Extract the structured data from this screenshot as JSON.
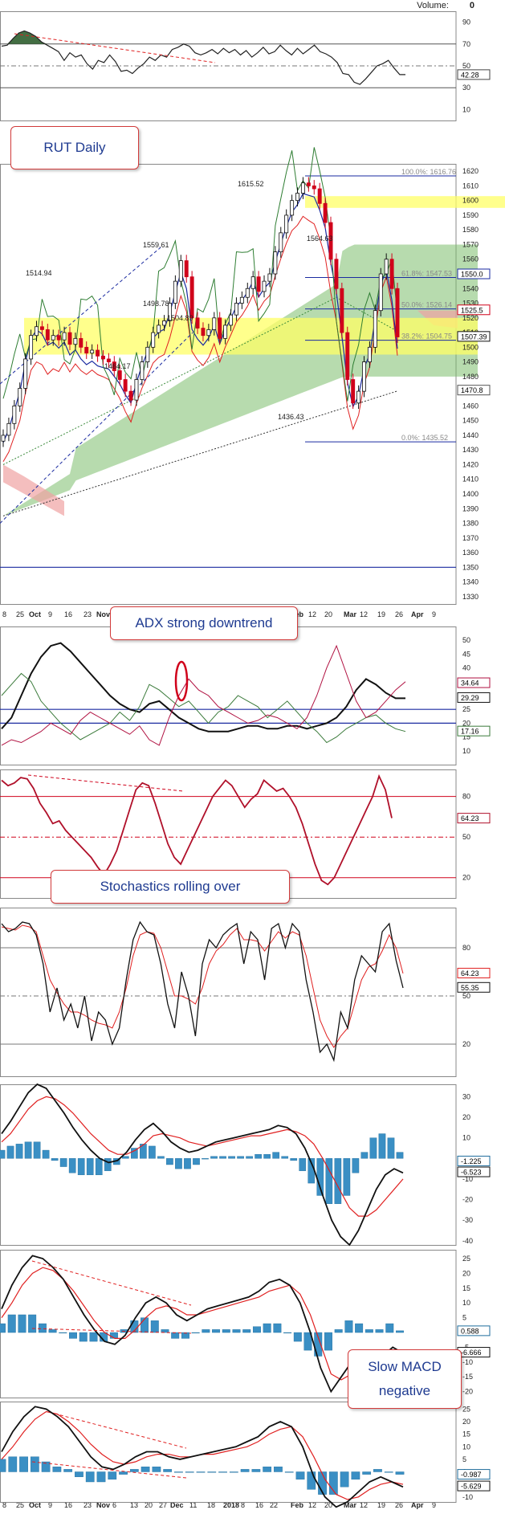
{
  "volume": {
    "label": "Volume:",
    "value": "0"
  },
  "callouts": {
    "rut": "RUT Daily",
    "adx": "ADX strong downtrend",
    "stoch": "Stochastics rolling over",
    "slow_macd": "Slow MACD negative"
  },
  "x_axis": {
    "labels": [
      "8",
      "25",
      "Oct",
      "9",
      "16",
      "23",
      "Nov",
      "6",
      "13",
      "20",
      "27",
      "Dec",
      "11",
      "18",
      "2018",
      "8",
      "16",
      "22",
      "Feb",
      "12",
      "20",
      "Mar",
      "12",
      "19",
      "26",
      "Apr",
      "9"
    ],
    "bold": [
      "Oct",
      "Nov",
      "Dec",
      "2018",
      "Feb",
      "Mar",
      "Apr"
    ],
    "num_days": 140
  },
  "colors": {
    "price_up": "#111111",
    "price_down": "#d0021b",
    "red_line": "#e02020",
    "blue_line": "#1a2aa0",
    "green_line": "#2e7d32",
    "cloud_green": "#7cbd6b",
    "cloud_red": "#f0a3a3",
    "highlight": "#ffff66",
    "macd_hist": "#3a8fc4",
    "rsi_fill": "#2f5e2f"
  },
  "chart_data": [
    {
      "type": "line",
      "panel": "RSI",
      "y_ticks": [
        "90",
        "70",
        "50",
        "30",
        "10"
      ],
      "last_label": "42.28",
      "levels": [
        70,
        50,
        30
      ],
      "series": [
        {
          "values": [
            68,
            69,
            75,
            80,
            82,
            80,
            77,
            72,
            69,
            66,
            63,
            55,
            62,
            58,
            60,
            52,
            47,
            55,
            53,
            60,
            54,
            45,
            46,
            43,
            48,
            52,
            58,
            55,
            60,
            58,
            65,
            67,
            70,
            68,
            62,
            60,
            62,
            65,
            61,
            66,
            62,
            65,
            60,
            64,
            58,
            62,
            67,
            61,
            63,
            69,
            64,
            60,
            66,
            61,
            65,
            69,
            63,
            61,
            58,
            53,
            43,
            42,
            35,
            33,
            38,
            44,
            50,
            52,
            55,
            48,
            42,
            42
          ]
        }
      ]
    },
    {
      "type": "candlestick",
      "panel": "price",
      "title": "RUT Daily",
      "y_ticks": [
        "1620",
        "1610",
        "1600",
        "1590",
        "1580",
        "1570",
        "1560",
        "1550",
        "1540",
        "1530",
        "1520",
        "1510",
        "1500",
        "1490",
        "1480",
        "1470",
        "1460",
        "1450",
        "1440",
        "1430",
        "1420",
        "1410",
        "1400",
        "1390",
        "1380",
        "1370",
        "1360",
        "1350",
        "1340",
        "1330"
      ],
      "ylim": [
        1325,
        1625
      ],
      "annotations": [
        "1615.52",
        "1559.61",
        "1514.94",
        "1498.78",
        "1504.89",
        "1464.17",
        "1564.63",
        "1436.43"
      ],
      "fib_levels": [
        {
          "label": "100.0%: 1616.76",
          "value": 1616.76
        },
        {
          "label": "61.8%: 1547.53",
          "value": 1547.53
        },
        {
          "label": "50.0%: 1526.14",
          "value": 1526.14
        },
        {
          "label": "38.2%: 1504.75",
          "value": 1504.75
        },
        {
          "label": "0.0%: 1435.52",
          "value": 1435.52
        }
      ],
      "last_labels": [
        "1550.0",
        "1525.5",
        "1507.39",
        "1470.8"
      ],
      "highlight_zones": [
        [
          1495,
          1520
        ],
        [
          1595,
          1603
        ]
      ],
      "closes": [
        1440,
        1448,
        1460,
        1472,
        1492,
        1508,
        1514,
        1512,
        1505,
        1508,
        1505,
        1510,
        1502,
        1506,
        1500,
        1496,
        1498,
        1494,
        1492,
        1490,
        1484,
        1478,
        1470,
        1464,
        1478,
        1490,
        1500,
        1510,
        1515,
        1518,
        1530,
        1545,
        1559,
        1548,
        1520,
        1513,
        1508,
        1512,
        1520,
        1506,
        1515,
        1522,
        1530,
        1534,
        1540,
        1548,
        1538,
        1545,
        1550,
        1565,
        1578,
        1590,
        1600,
        1605,
        1612,
        1610,
        1608,
        1598,
        1585,
        1560,
        1540,
        1510,
        1478,
        1462,
        1470,
        1490,
        1500,
        1525,
        1550,
        1560,
        1540,
        1507
      ]
    },
    {
      "type": "line",
      "panel": "ADX",
      "title": "ADX strong downtrend",
      "y_ticks": [
        "50",
        "45",
        "40",
        "35",
        "30",
        "25",
        "20",
        "15",
        "10"
      ],
      "levels": [
        25,
        20
      ],
      "last_labels": [
        "34.64",
        "29.29",
        "17.16"
      ],
      "series": [
        {
          "name": "ADX",
          "values": [
            18,
            22,
            30,
            38,
            44,
            48,
            49,
            46,
            42,
            38,
            34,
            30,
            27,
            25,
            24,
            27,
            28,
            25,
            22,
            20,
            18,
            17,
            17,
            17,
            18,
            19,
            19,
            18,
            18,
            19,
            19,
            18,
            19,
            20,
            22,
            26,
            32,
            36,
            34,
            31,
            29,
            29
          ]
        },
        {
          "name": "+DI",
          "values": [
            30,
            34,
            38,
            35,
            28,
            24,
            20,
            17,
            14,
            16,
            18,
            20,
            24,
            21,
            26,
            34,
            32,
            29,
            26,
            28,
            24,
            20,
            24,
            26,
            30,
            28,
            26,
            22,
            25,
            28,
            24,
            20,
            17,
            13,
            15,
            18,
            20,
            22,
            23,
            20,
            18,
            17
          ]
        },
        {
          "name": "-DI",
          "values": [
            12,
            14,
            13,
            15,
            17,
            20,
            18,
            16,
            21,
            24,
            22,
            20,
            18,
            16,
            19,
            14,
            12,
            22,
            30,
            36,
            32,
            30,
            26,
            24,
            22,
            20,
            21,
            23,
            22,
            20,
            18,
            22,
            30,
            40,
            48,
            38,
            28,
            22,
            24,
            28,
            32,
            35
          ]
        }
      ]
    },
    {
      "type": "line",
      "panel": "RSI2",
      "y_ticks": [
        "80",
        "50",
        "20"
      ],
      "levels": [
        80,
        50,
        20
      ],
      "last_label": "64.23",
      "series": [
        {
          "values": [
            92,
            88,
            90,
            94,
            93,
            86,
            75,
            68,
            60,
            62,
            55,
            50,
            45,
            40,
            35,
            28,
            22,
            30,
            40,
            55,
            70,
            85,
            90,
            88,
            75,
            60,
            45,
            35,
            30,
            40,
            50,
            60,
            70,
            80,
            86,
            92,
            88,
            80,
            72,
            78,
            82,
            92,
            88,
            84,
            86,
            80,
            72,
            60,
            45,
            30,
            18,
            15,
            20,
            30,
            40,
            50,
            60,
            70,
            80,
            95,
            85,
            64
          ]
        }
      ]
    },
    {
      "type": "line",
      "panel": "Stochastics",
      "title": "Stochastics rolling over",
      "y_ticks": [
        "80",
        "50",
        "20"
      ],
      "levels": [
        80,
        50,
        20
      ],
      "last_labels": [
        "64.23",
        "55.35"
      ],
      "series": [
        {
          "name": "%K",
          "values": [
            95,
            90,
            92,
            96,
            95,
            88,
            70,
            40,
            55,
            35,
            45,
            30,
            50,
            22,
            40,
            35,
            20,
            30,
            60,
            85,
            96,
            90,
            88,
            70,
            45,
            30,
            65,
            50,
            25,
            70,
            85,
            80,
            88,
            92,
            95,
            70,
            90,
            85,
            60,
            92,
            95,
            80,
            95,
            90,
            60,
            40,
            15,
            20,
            10,
            40,
            30,
            60,
            75,
            70,
            65,
            90,
            95,
            72,
            55
          ]
        },
        {
          "name": "%D",
          "values": [
            93,
            92,
            91,
            94,
            93,
            90,
            75,
            60,
            52,
            45,
            40,
            40,
            38,
            35,
            33,
            32,
            30,
            40,
            55,
            75,
            88,
            90,
            89,
            80,
            65,
            50,
            50,
            48,
            45,
            55,
            70,
            78,
            82,
            88,
            92,
            85,
            85,
            84,
            78,
            84,
            90,
            86,
            90,
            88,
            75,
            55,
            35,
            25,
            18,
            25,
            30,
            45,
            60,
            68,
            70,
            78,
            88,
            80,
            64
          ]
        }
      ]
    },
    {
      "type": "line",
      "panel": "MACD",
      "y_ticks": [
        "30",
        "20",
        "10",
        "0",
        "-10",
        "-20",
        "-30",
        "-40"
      ],
      "last_labels": [
        "-1.225",
        "-6.523"
      ],
      "series": [
        {
          "name": "MACD",
          "values": [
            12,
            18,
            25,
            32,
            36,
            34,
            28,
            22,
            15,
            9,
            4,
            0,
            -2,
            -1,
            3,
            9,
            14,
            17,
            13,
            8,
            5,
            3,
            4,
            6,
            8,
            9,
            10,
            11,
            12,
            13,
            14,
            16,
            15,
            12,
            5,
            -5,
            -18,
            -30,
            -38,
            -42,
            -35,
            -25,
            -15,
            -8,
            -5,
            -7
          ]
        },
        {
          "name": "Signal",
          "values": [
            8,
            12,
            18,
            24,
            28,
            30,
            29,
            26,
            22,
            17,
            12,
            8,
            4,
            2,
            2,
            4,
            7,
            11,
            12,
            11,
            10,
            8,
            7,
            6,
            7,
            8,
            9,
            10,
            11,
            11,
            12,
            13,
            14,
            13,
            11,
            7,
            0,
            -8,
            -16,
            -24,
            -28,
            -28,
            -25,
            -20,
            -15,
            -10
          ]
        },
        {
          "name": "Histogram",
          "values": [
            4,
            6,
            7,
            8,
            8,
            4,
            -1,
            -4,
            -7,
            -8,
            -8,
            -8,
            -6,
            -3,
            1,
            5,
            7,
            6,
            1,
            -3,
            -5,
            -5,
            -3,
            0,
            1,
            1,
            1,
            1,
            1,
            2,
            2,
            3,
            1,
            -1,
            -6,
            -12,
            -18,
            -22,
            -22,
            -18,
            -7,
            3,
            10,
            12,
            10,
            3
          ]
        }
      ]
    },
    {
      "type": "line",
      "panel": "MACD2",
      "y_ticks": [
        "25",
        "20",
        "15",
        "10",
        "5",
        "0",
        "-5",
        "-10",
        "-15",
        "-20"
      ],
      "last_labels": [
        "0.588",
        "-6.666"
      ],
      "series": [
        {
          "name": "MACD",
          "values": [
            8,
            16,
            22,
            26,
            25,
            22,
            18,
            12,
            6,
            1,
            -3,
            -4,
            -1,
            5,
            10,
            12,
            10,
            6,
            4,
            6,
            8,
            9,
            10,
            11,
            12,
            14,
            17,
            18,
            16,
            10,
            0,
            -12,
            -20,
            -15,
            -10,
            -8,
            -9,
            -8,
            -5,
            -7
          ]
        },
        {
          "name": "Signal",
          "values": [
            5,
            10,
            16,
            20,
            22,
            21,
            18,
            14,
            9,
            4,
            0,
            -2,
            -2,
            1,
            5,
            8,
            9,
            8,
            6,
            6,
            7,
            8,
            9,
            10,
            11,
            12,
            14,
            15,
            16,
            13,
            6,
            -4,
            -14,
            -16,
            -14,
            -11,
            -10,
            -9,
            -8,
            -7
          ]
        },
        {
          "name": "Histogram",
          "values": [
            3,
            6,
            6,
            6,
            3,
            1,
            0,
            -2,
            -3,
            -3,
            -3,
            -2,
            1,
            4,
            5,
            4,
            1,
            -2,
            -2,
            0,
            1,
            1,
            1,
            1,
            1,
            2,
            3,
            3,
            0,
            -3,
            -6,
            -8,
            -6,
            1,
            4,
            3,
            1,
            1,
            3,
            0.6
          ]
        }
      ]
    },
    {
      "type": "line",
      "panel": "Slow MACD",
      "title": "Slow MACD negative",
      "y_ticks": [
        "25",
        "20",
        "15",
        "10",
        "5",
        "0",
        "-5",
        "-10"
      ],
      "last_labels": [
        "-0.987",
        "-5.629"
      ],
      "series": [
        {
          "name": "MACD",
          "values": [
            8,
            16,
            22,
            26,
            25,
            22,
            18,
            12,
            6,
            2,
            1,
            3,
            6,
            8,
            8,
            6,
            5,
            6,
            7,
            8,
            9,
            10,
            12,
            14,
            18,
            20,
            18,
            10,
            -2,
            -10,
            -14,
            -12,
            -8,
            -4,
            -2,
            -4,
            -6
          ]
        },
        {
          "name": "Signal",
          "values": [
            5,
            10,
            16,
            21,
            24,
            23,
            20,
            16,
            11,
            7,
            4,
            3,
            4,
            6,
            7,
            7,
            6,
            6,
            7,
            7,
            8,
            9,
            10,
            12,
            15,
            17,
            18,
            14,
            6,
            -3,
            -9,
            -11,
            -10,
            -7,
            -5,
            -4,
            -5
          ]
        },
        {
          "name": "Histogram",
          "values": [
            5,
            6,
            6,
            6,
            4,
            2,
            1,
            -2,
            -4,
            -4,
            -3,
            -1,
            1,
            2,
            2,
            1,
            0,
            0,
            0,
            0,
            0,
            0,
            1,
            1,
            2,
            2,
            0,
            -3,
            -7,
            -9,
            -9,
            -6,
            -3,
            -1,
            1,
            0,
            -1
          ]
        }
      ]
    }
  ]
}
